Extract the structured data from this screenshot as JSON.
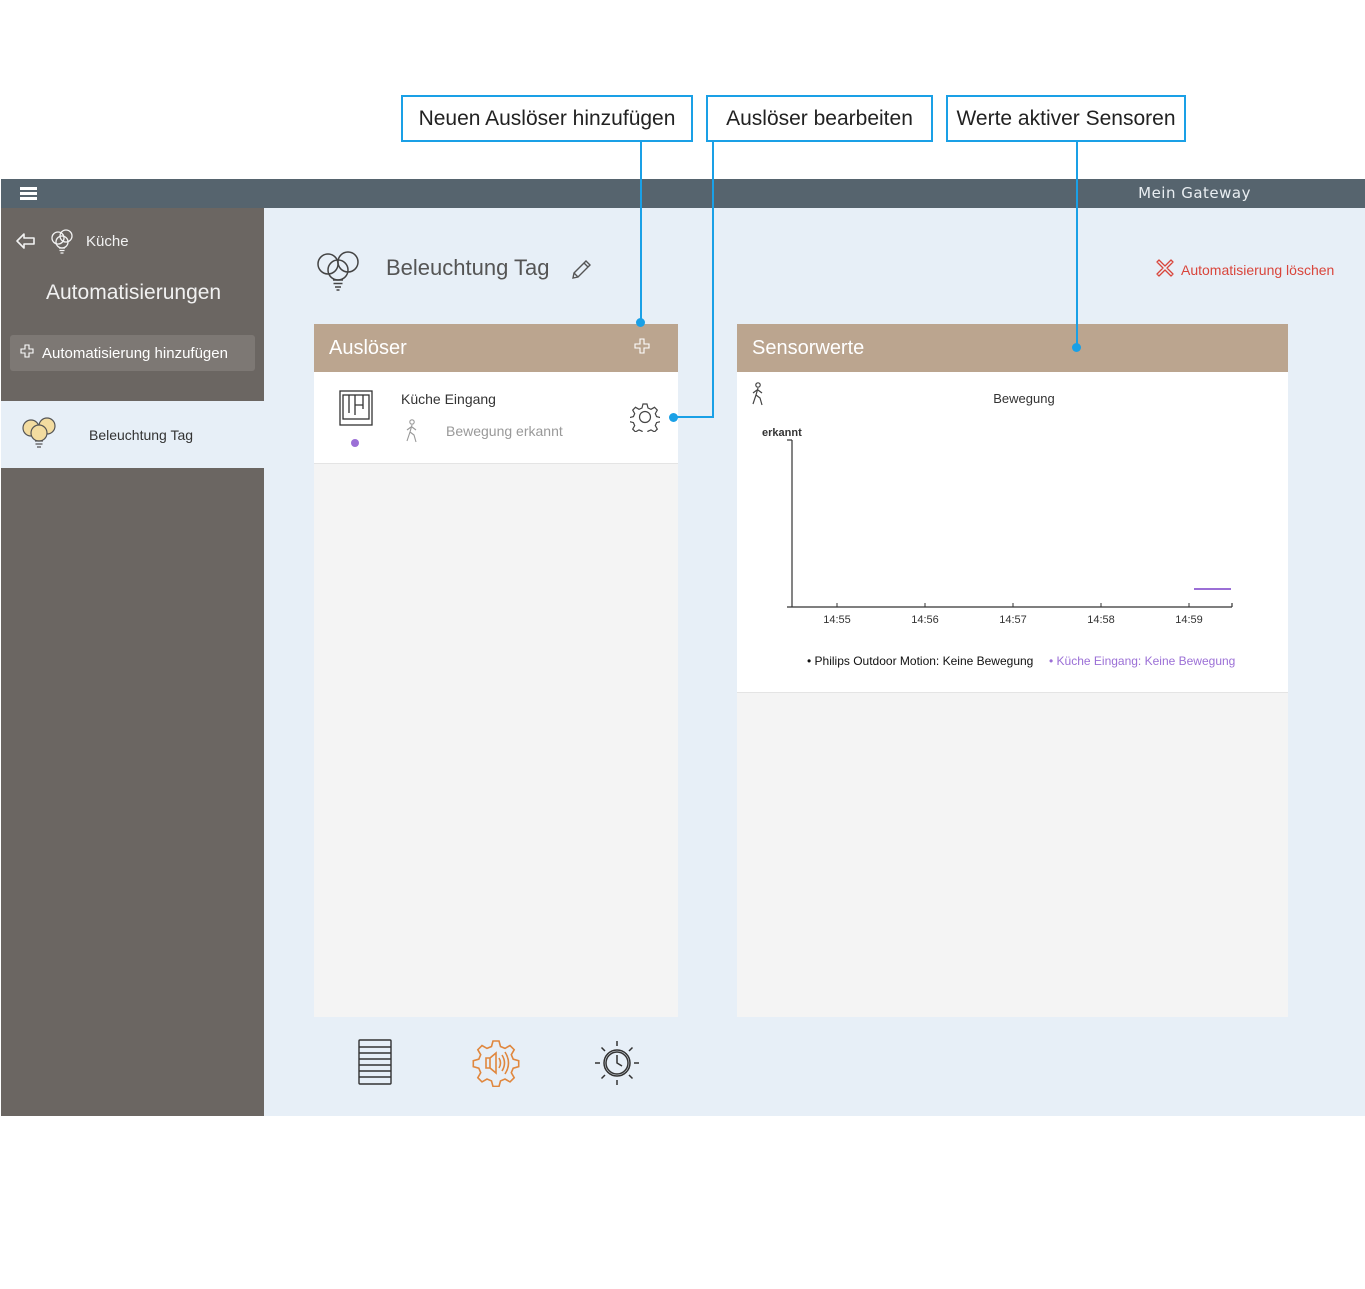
{
  "callouts": {
    "add_trigger": "Neuen Auslöser hinzufügen",
    "edit_trigger": "Auslöser bearbeiten",
    "sensor_values": "Werte aktiver Sensoren"
  },
  "topbar": {
    "gateway_label": "Mein Gateway"
  },
  "sidebar": {
    "room": "Küche",
    "title": "Automatisierungen",
    "add_button": "Automatisierung hinzufügen",
    "items": [
      {
        "label": "Beleuchtung Tag"
      }
    ]
  },
  "main": {
    "title": "Beleuchtung Tag",
    "delete_label": "Automatisierung löschen"
  },
  "triggers": {
    "header": "Auslöser",
    "items": [
      {
        "device": "Küche Eingang",
        "event": "Bewegung erkannt"
      }
    ]
  },
  "sensors": {
    "header": "Sensorwerte"
  },
  "chart_data": {
    "type": "line",
    "title": "Bewegung",
    "ylabel": "erkannt",
    "xlabel": "",
    "x_ticks": [
      "14:55",
      "14:56",
      "14:57",
      "14:58",
      "14:59"
    ],
    "series": [
      {
        "name": "Philips Outdoor Motion: Keine Bewegung",
        "color": "#111111",
        "segments": []
      },
      {
        "name": "Küche Eingang: Keine Bewegung",
        "color": "#9b6fd6",
        "segments": [
          {
            "from": "14:59",
            "to": "14:59:30",
            "state": "Keine Bewegung"
          }
        ]
      }
    ],
    "legend_position": "bottom"
  },
  "colors": {
    "accent_callout": "#1aa0e6",
    "panel_header": "#bba58f",
    "sidebar": "#6b6662",
    "topbar": "#56646e",
    "delete": "#d9453b",
    "active_bottom_icon": "#e0873e",
    "series_purple": "#9b6fd6"
  },
  "bottom_nav": [
    {
      "icon": "list-icon",
      "active": false
    },
    {
      "icon": "sensor-gear-icon",
      "active": true
    },
    {
      "icon": "sun-clock-icon",
      "active": false
    }
  ]
}
